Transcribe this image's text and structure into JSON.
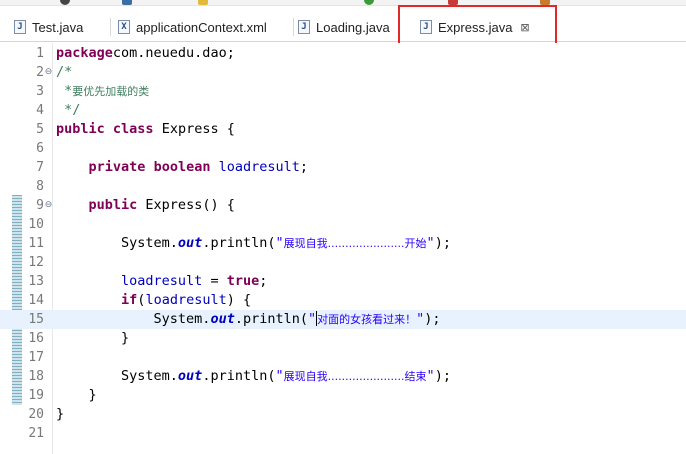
{
  "tabs": [
    {
      "id": "test",
      "label": "Test.java",
      "icon": "java-file-icon",
      "icon_glyph": "J",
      "active": false
    },
    {
      "id": "appctx",
      "label": "applicationContext.xml",
      "icon": "xml-file-icon",
      "icon_glyph": "X",
      "active": false
    },
    {
      "id": "loading",
      "label": "Loading.java",
      "icon": "java-file-icon",
      "icon_glyph": "J",
      "active": false
    },
    {
      "id": "express",
      "label": "Express.java",
      "icon": "java-file-icon",
      "icon_glyph": "J",
      "active": true,
      "close_glyph": "⊠"
    }
  ],
  "colors": {
    "keyword": "#7f0055",
    "comment": "#3f7f5f",
    "string": "#2a00ff",
    "field": "#0000c0",
    "current_line": "#e8f2fe",
    "highlight_box": "#e02a2a"
  },
  "editor": {
    "current_line": 15,
    "fold_glyph": "⊖",
    "lines": [
      {
        "n": "1",
        "tokens": [
          [
            "kw",
            "package"
          ],
          [
            "",
            "com.neuedu.dao;"
          ]
        ]
      },
      {
        "n": "2",
        "fold": true,
        "tokens": [
          [
            "cm",
            "/*"
          ]
        ]
      },
      {
        "n": "3",
        "tokens": [
          [
            "cm",
            " *"
          ],
          [
            "cjk-cm",
            "要优先加载的类"
          ]
        ]
      },
      {
        "n": "4",
        "tokens": [
          [
            "cm",
            " */"
          ]
        ]
      },
      {
        "n": "5",
        "tokens": [
          [
            "kw",
            "public"
          ],
          [
            "",
            " "
          ],
          [
            "kw",
            "class"
          ],
          [
            "",
            " Express {"
          ]
        ]
      },
      {
        "n": "6",
        "tokens": []
      },
      {
        "n": "7",
        "tokens": [
          [
            "",
            "    "
          ],
          [
            "kw",
            "private"
          ],
          [
            "",
            " "
          ],
          [
            "kw",
            "boolean"
          ],
          [
            "",
            " "
          ],
          [
            "fld",
            "loadresult"
          ],
          [
            "",
            ";"
          ]
        ]
      },
      {
        "n": "8",
        "tokens": []
      },
      {
        "n": "9",
        "fold": true,
        "tokens": [
          [
            "",
            "    "
          ],
          [
            "kw",
            "public"
          ],
          [
            "",
            " Express() {"
          ]
        ]
      },
      {
        "n": "10",
        "tokens": []
      },
      {
        "n": "11",
        "tokens": [
          [
            "",
            "        System."
          ],
          [
            "sfld",
            "out"
          ],
          [
            "",
            ".println("
          ],
          [
            "str",
            "\""
          ],
          [
            "cjk str",
            "展现自我......................开始"
          ],
          [
            "str",
            "\""
          ],
          [
            "",
            ");"
          ]
        ]
      },
      {
        "n": "12",
        "tokens": []
      },
      {
        "n": "13",
        "tokens": [
          [
            "",
            "        "
          ],
          [
            "fld",
            "loadresult"
          ],
          [
            "",
            " = "
          ],
          [
            "kw",
            "true"
          ],
          [
            "",
            ";"
          ]
        ]
      },
      {
        "n": "14",
        "tokens": [
          [
            "",
            "        "
          ],
          [
            "kw",
            "if"
          ],
          [
            "",
            "("
          ],
          [
            "fld",
            "loadresult"
          ],
          [
            "",
            ") {"
          ]
        ]
      },
      {
        "n": "15",
        "tokens": [
          [
            "",
            "            System."
          ],
          [
            "sfld",
            "out"
          ],
          [
            "",
            ".println("
          ],
          [
            "str",
            "\""
          ],
          [
            "caret",
            ""
          ],
          [
            "cjk str",
            "对面的女孩看过来！"
          ],
          [
            "str",
            "\""
          ],
          [
            "",
            ");"
          ]
        ]
      },
      {
        "n": "16",
        "tokens": [
          [
            "",
            "        }"
          ]
        ]
      },
      {
        "n": "17",
        "tokens": []
      },
      {
        "n": "18",
        "tokens": [
          [
            "",
            "        System."
          ],
          [
            "sfld",
            "out"
          ],
          [
            "",
            ".println("
          ],
          [
            "str",
            "\""
          ],
          [
            "cjk str",
            "展现自我......................结束"
          ],
          [
            "str",
            "\""
          ],
          [
            "",
            ");"
          ]
        ]
      },
      {
        "n": "19",
        "tokens": [
          [
            "",
            "    }"
          ]
        ]
      },
      {
        "n": "20",
        "tokens": [
          [
            "",
            "}"
          ]
        ]
      },
      {
        "n": "21",
        "tokens": []
      }
    ]
  }
}
